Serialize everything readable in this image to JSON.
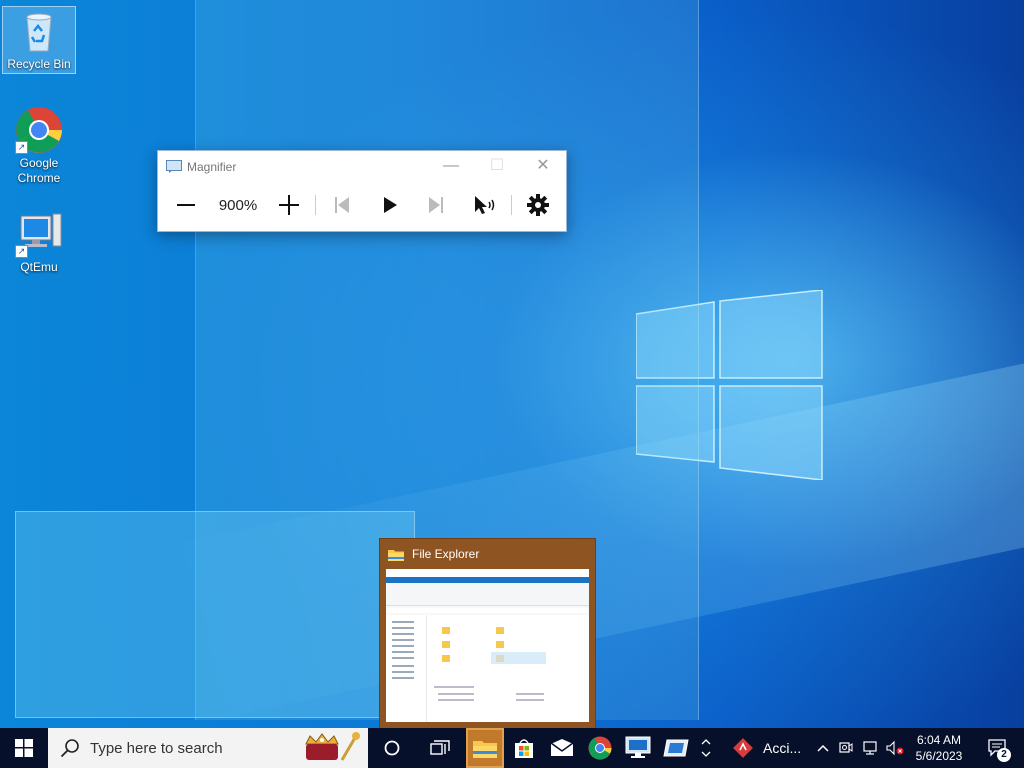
{
  "desktop": {
    "icons": [
      {
        "label": "Recycle Bin",
        "icon": "recycle-bin-icon"
      },
      {
        "label": "Google Chrome",
        "icon": "chrome-icon"
      },
      {
        "label": "QtEmu",
        "icon": "computer-icon"
      }
    ]
  },
  "magnifier": {
    "title": "Magnifier",
    "zoom_level": "900%",
    "controls": [
      "zoom-out",
      "zoom-in",
      "previous",
      "play",
      "next",
      "read-from-here",
      "settings"
    ]
  },
  "file_explorer_preview": {
    "title": "File Explorer"
  },
  "taskbar": {
    "search_placeholder": "Type here to search",
    "pinned": [
      "task-view-icon",
      "file-explorer-icon",
      "store-icon",
      "mail-icon",
      "chrome-icon",
      "remote-desktop-icon",
      "qtemu-icon"
    ],
    "active_app": "File Explorer",
    "notification_app_label": "Acci...",
    "time": "6:04 AM",
    "date": "5/6/2023",
    "notification_count": "2"
  },
  "colors": {
    "taskbar_bg": "#07102a",
    "active_app_bg": "#c17a2c",
    "preview_bg": "#8e5522"
  }
}
